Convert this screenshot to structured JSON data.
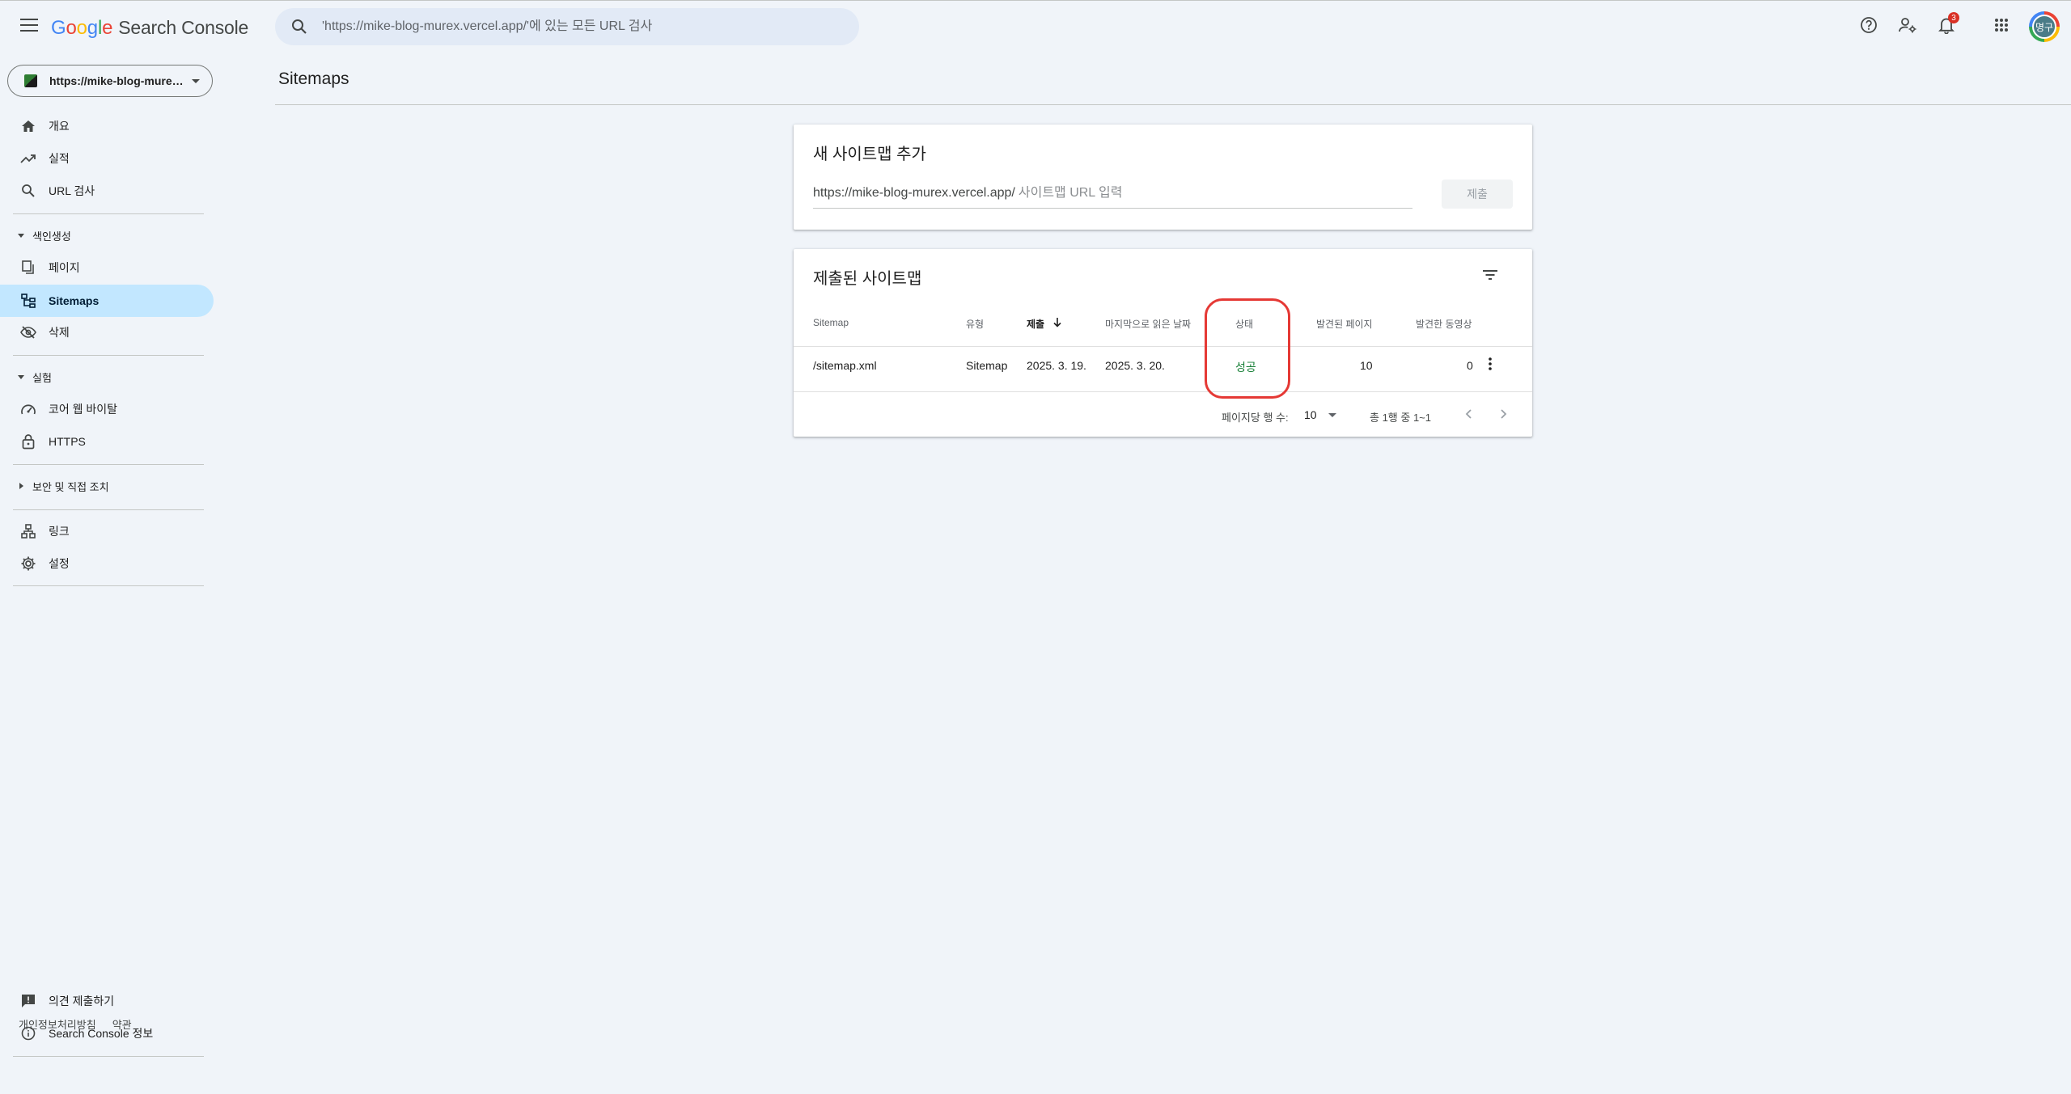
{
  "header": {
    "product_name": "Search Console",
    "search_placeholder": "'https://mike-blog-murex.vercel.app/'에 있는 모든 URL 검사",
    "notification_count": "3",
    "avatar_initials": "명구"
  },
  "sidebar": {
    "property": "https://mike-blog-murex.vercel.app/",
    "items": {
      "overview": "개요",
      "performance": "실적",
      "url_inspection": "URL 검사",
      "indexing_section": "색인생성",
      "pages": "페이지",
      "sitemaps": "Sitemaps",
      "removals": "삭제",
      "experience_section": "실험",
      "core_web_vitals": "코어 웹 바이탈",
      "https": "HTTPS",
      "security_section": "보안 및 직접 조치",
      "links": "링크",
      "settings": "설정",
      "feedback": "의견 제출하기",
      "about": "Search Console 정보"
    },
    "footer": {
      "privacy": "개인정보처리방침",
      "terms": "약관"
    }
  },
  "main": {
    "page_title": "Sitemaps",
    "add_card": {
      "title": "새 사이트맵 추가",
      "url_prefix": "https://mike-blog-murex.vercel.app/",
      "input_placeholder": "사이트맵 URL 입력",
      "submit_label": "제출"
    },
    "submitted_card": {
      "title": "제출된 사이트맵",
      "columns": {
        "sitemap": "Sitemap",
        "type": "유형",
        "submitted": "제출",
        "last_read": "마지막으로 읽은 날짜",
        "status": "상태",
        "discovered_pages": "발견된 페이지",
        "discovered_videos": "발견한 동영상"
      },
      "rows": [
        {
          "sitemap": "/sitemap.xml",
          "type": "Sitemap",
          "submitted": "2025. 3. 19.",
          "last_read": "2025. 3. 20.",
          "status": "성공",
          "discovered_pages": "10",
          "discovered_videos": "0"
        }
      ],
      "pager": {
        "rows_per_page_label": "페이지당 행 수:",
        "rows_per_page_value": "10",
        "range_text": "총 1행 중 1~1"
      }
    }
  },
  "colors": {
    "success": "#188038",
    "active_nav": "#c2e7ff",
    "highlight_ring": "#e53935"
  }
}
